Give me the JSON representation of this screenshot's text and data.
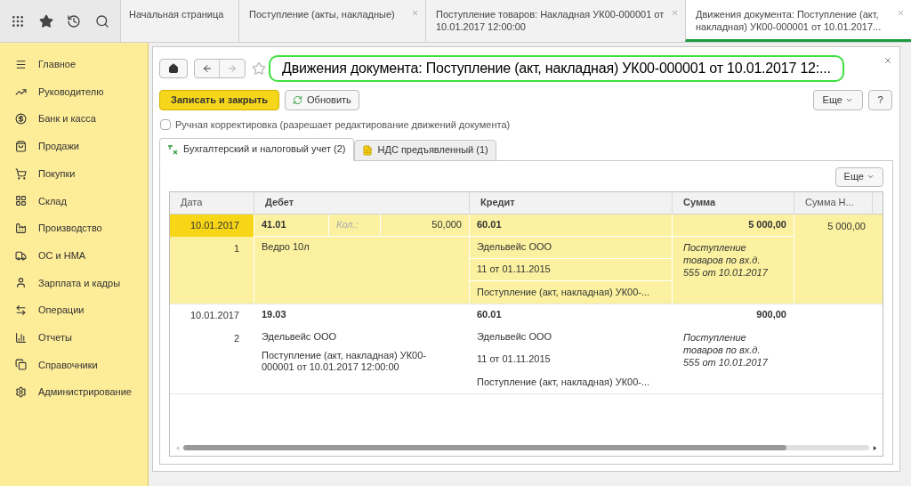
{
  "top_tabs": [
    {
      "label": "Начальная страница",
      "closable": false,
      "selected": false
    },
    {
      "label": "Поступление (акты, накладные)",
      "closable": true,
      "selected": false
    },
    {
      "label": "Поступление товаров: Накладная УК00-000001 от 10.01.2017 12:00:00",
      "closable": true,
      "selected": false
    },
    {
      "label": "Движения документа: Поступление (акт, накладная) УК00-000001 от 10.01.2017...",
      "closable": true,
      "selected": true
    }
  ],
  "sidebar": {
    "items": [
      "Главное",
      "Руководителю",
      "Банк и касса",
      "Продажи",
      "Покупки",
      "Склад",
      "Производство",
      "ОС и НМА",
      "Зарплата и кадры",
      "Операции",
      "Отчеты",
      "Справочники",
      "Администрирование"
    ]
  },
  "form": {
    "title": "Движения документа: Поступление (акт, накладная) УК00-000001 от 10.01.2017 12:...",
    "buttons": {
      "primary": "Записать и закрыть",
      "refresh": "Обновить",
      "more": "Еще",
      "help": "?"
    },
    "manual_edit": {
      "label": "Ручная корректировка (разрешает редактирование движений документа)",
      "checked": false
    },
    "tabs": [
      {
        "label": "Бухгалтерский и налоговый учет (2)",
        "selected": true
      },
      {
        "label": "НДС предъявленный (1)",
        "selected": false
      }
    ],
    "table_more": "Еще",
    "table": {
      "columns": [
        "Дата",
        "Дебет",
        "Кредит",
        "Сумма",
        "Сумма Н..."
      ],
      "rows": [
        {
          "selected": true,
          "date": "10.01.2017",
          "number": "1",
          "debit": "41.01",
          "qty_label": "Кол.:",
          "qty": "50,000",
          "debit_lines": [
            "Ведро 10л"
          ],
          "credit": "60.01",
          "credit_lines": [
            "Эдельвейс ООО",
            "11 от 01.11.2015",
            "Поступление (акт, накладная) УК00-..."
          ],
          "amount": "5 000,00",
          "content": "Поступление товаров по вх.д. 555 от 10.01.2017",
          "amount_tax": "5 000,00"
        },
        {
          "selected": false,
          "date": "10.01.2017",
          "number": "2",
          "debit": "19.03",
          "debit_lines": [
            "Эдельвейс ООО",
            "Поступление (акт, накладная) УК00-000001 от 10.01.2017 12:00:00"
          ],
          "credit": "60.01",
          "credit_lines": [
            "Эдельвейс ООО",
            "11 от 01.11.2015",
            "Поступление (акт, накладная) УК00-..."
          ],
          "amount": "900,00",
          "content": "Поступление товаров по вх.д. 555 от 10.01.2017"
        }
      ]
    }
  }
}
